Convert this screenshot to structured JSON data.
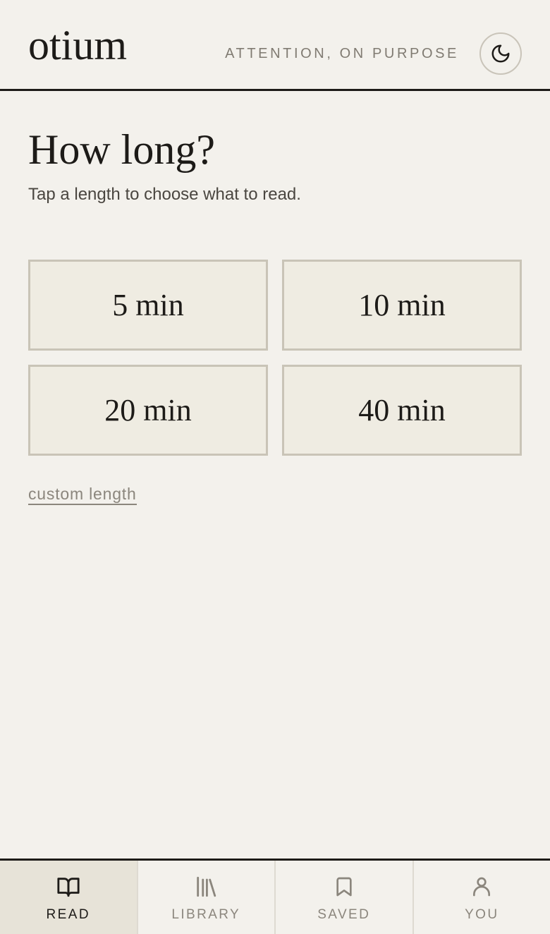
{
  "header": {
    "logo": "otium",
    "tagline": "ATTENTION, ON PURPOSE",
    "theme_toggle_icon": "moon-icon"
  },
  "main": {
    "title": "How long?",
    "subtitle": "Tap a length to choose what to read.",
    "options": [
      {
        "label": "5 min"
      },
      {
        "label": "10 min"
      },
      {
        "label": "20 min"
      },
      {
        "label": "40 min"
      }
    ],
    "custom_link": "custom length"
  },
  "nav": {
    "items": [
      {
        "label": "READ",
        "icon": "book-open-icon",
        "active": true
      },
      {
        "label": "LIBRARY",
        "icon": "library-icon",
        "active": false
      },
      {
        "label": "SAVED",
        "icon": "bookmark-icon",
        "active": false
      },
      {
        "label": "YOU",
        "icon": "user-icon",
        "active": false
      }
    ]
  },
  "colors": {
    "background": "#f3f1ec",
    "text": "#1d1b18",
    "muted": "#8b867d",
    "option_fill": "#efece2",
    "option_border": "#c9c4b7",
    "active_nav": "#e7e3d8"
  }
}
